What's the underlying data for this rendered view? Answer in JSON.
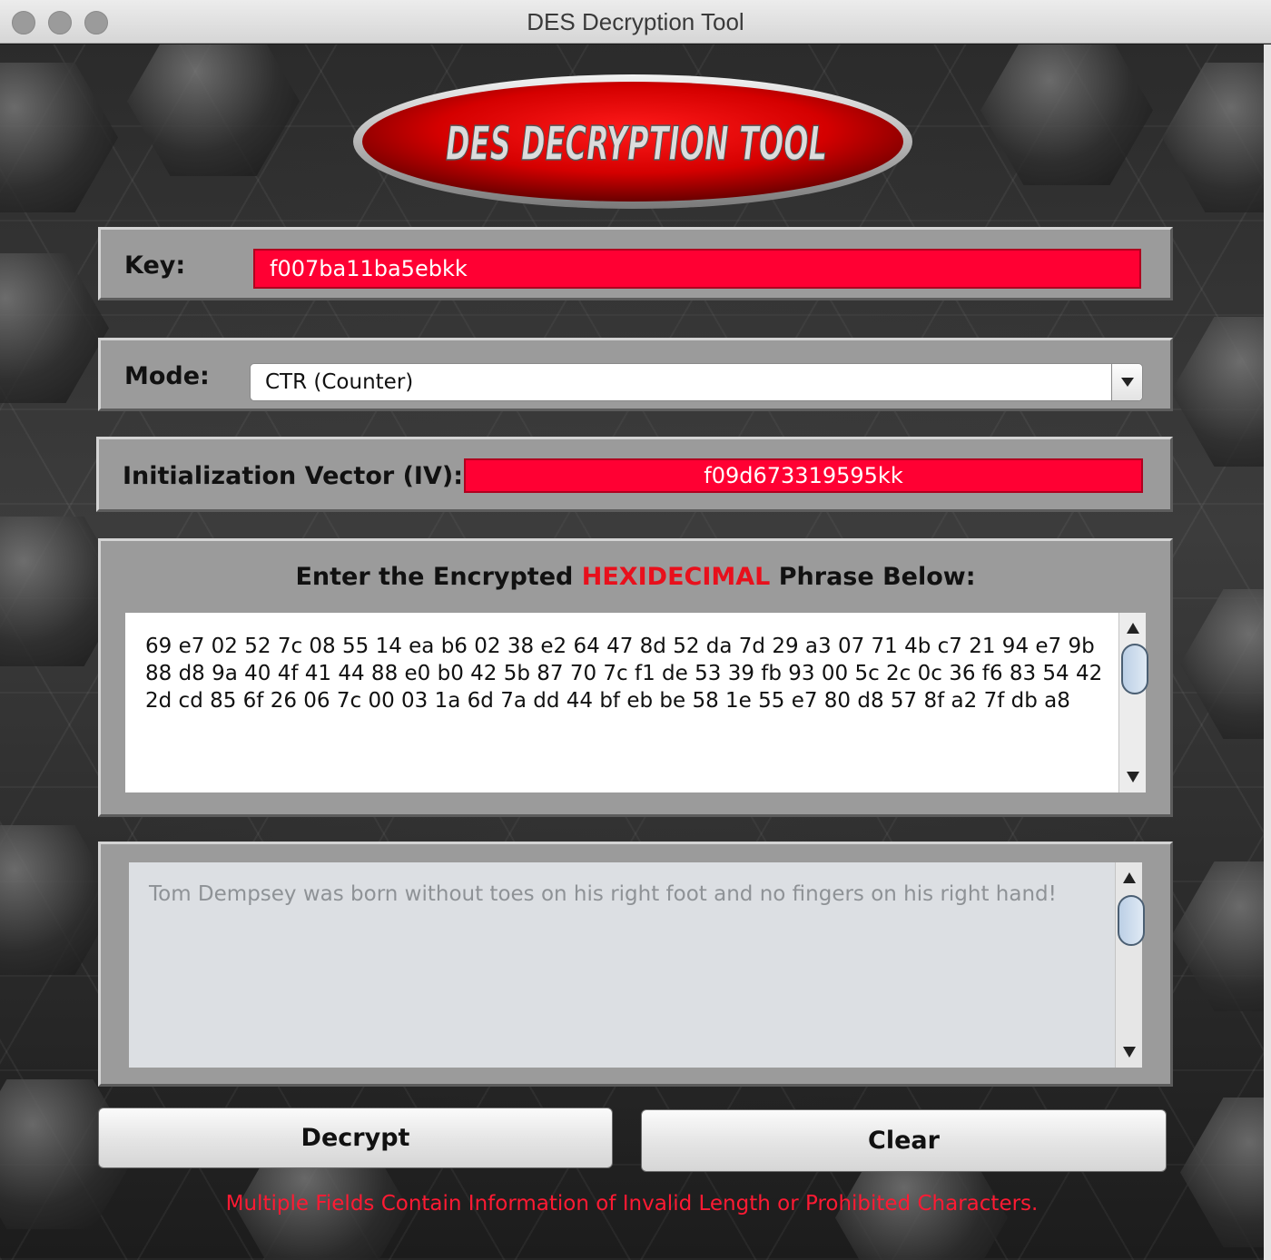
{
  "window": {
    "title": "DES Decryption Tool"
  },
  "logo": {
    "text": "DES DECRYPTION TOOL"
  },
  "key": {
    "label": "Key:",
    "value": "f007ba11ba5ebkk"
  },
  "mode": {
    "label": "Mode:",
    "value": "CTR (Counter)"
  },
  "iv": {
    "label": "Initialization Vector (IV):",
    "value": "f09d673319595kk"
  },
  "input": {
    "heading_prefix": "Enter the Encrypted ",
    "heading_highlight": "HEXIDECIMAL",
    "heading_suffix": " Phrase Below:",
    "value": "69 e7 02 52 7c 08 55 14 ea b6 02 38 e2 64 47 8d 52 da 7d 29 a3 07 71 4b c7 21 94 e7 9b 88 d8 9a 40 4f 41 44 88 e0 b0 42 5b 87 70 7c f1 de 53 39 fb 93 00 5c 2c 0c 36 f6 83 54 42 2d cd 85 6f 26 06 7c 00 03 1a 6d 7a dd 44 bf eb be 58 1e 55 e7 80 d8 57 8f a2 7f db a8"
  },
  "output": {
    "value": "Tom Dempsey was born without toes on his right foot and no fingers on his right hand!"
  },
  "buttons": {
    "decrypt": "Decrypt",
    "clear": "Clear"
  },
  "status": {
    "message": "Multiple Fields Contain Information of Invalid Length or Prohibited Characters."
  },
  "colors": {
    "error": "#ff1a33",
    "field_red": "#ff0033",
    "panel": "#9b9b9b",
    "highlight": "#e8101c"
  },
  "icons": {
    "dropdown": "chevron-down-icon",
    "scroll_up": "arrow-up-icon",
    "scroll_down": "arrow-down-icon"
  }
}
